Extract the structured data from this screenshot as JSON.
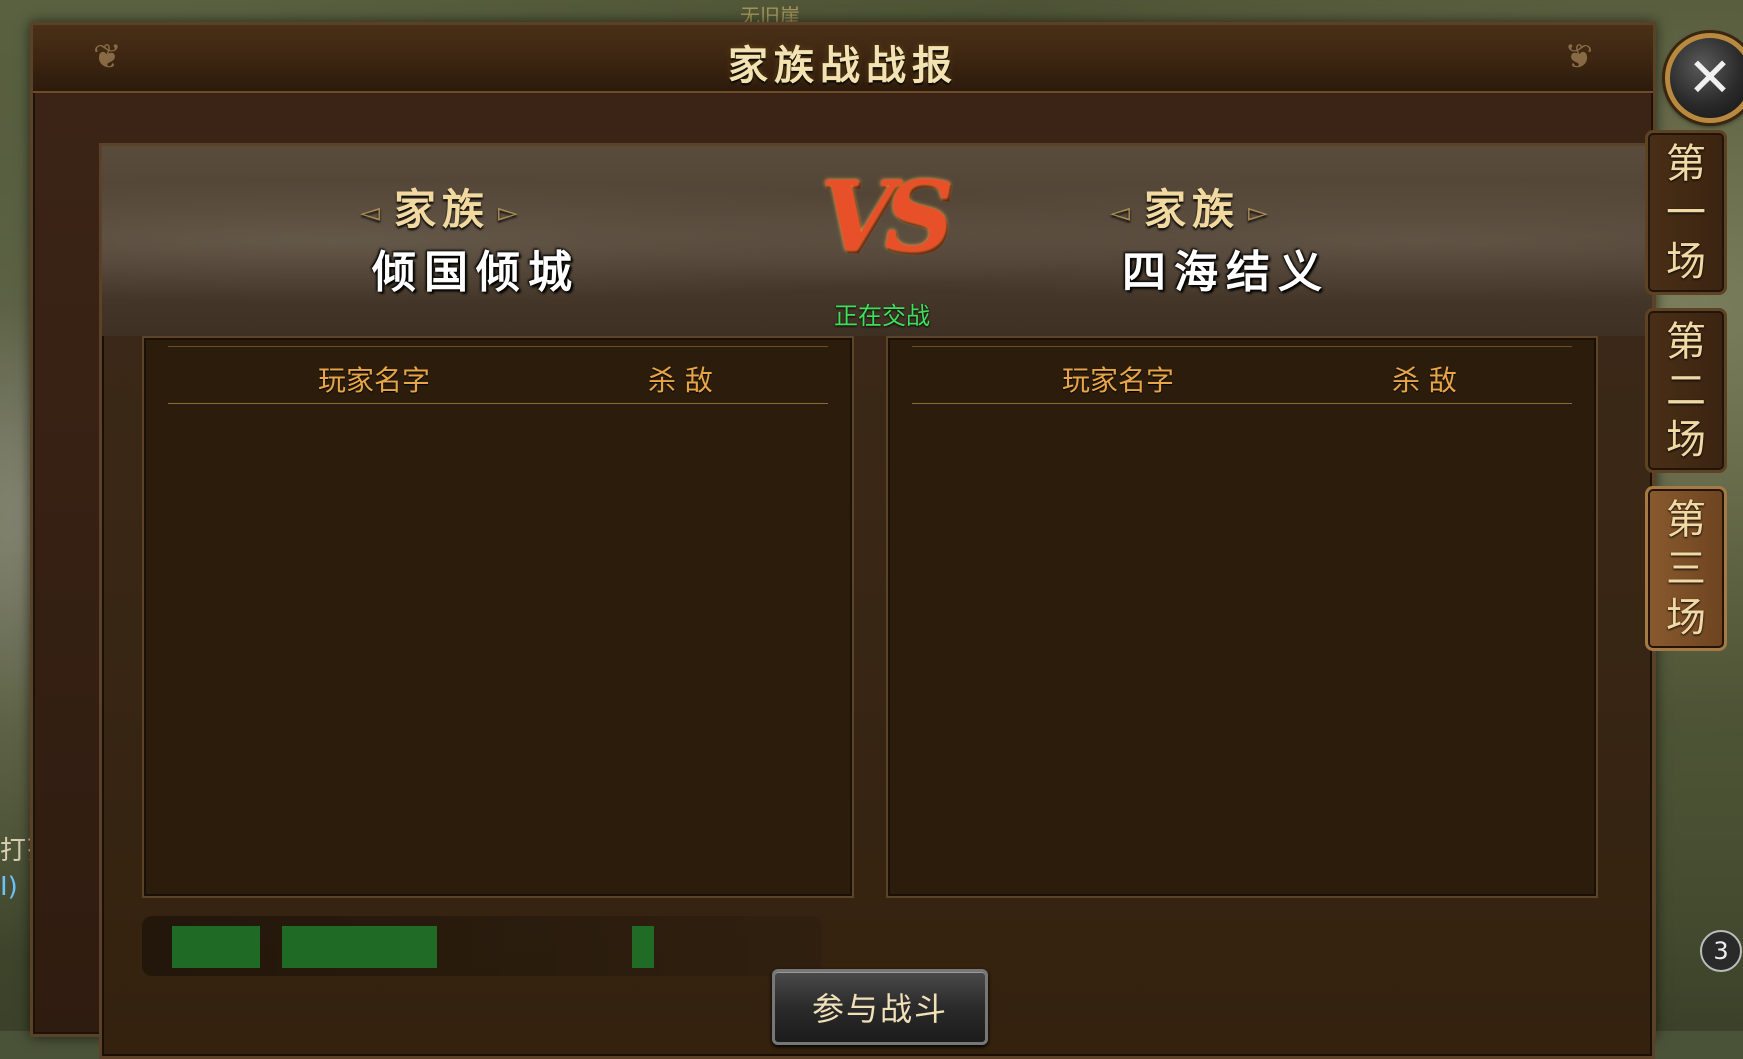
{
  "world": {
    "top_text": "无旧崖",
    "left_texts": [
      "打歹",
      "I)"
    ]
  },
  "window": {
    "title": "家族战战报",
    "close_icon": "close-icon"
  },
  "header": {
    "left_clan_label": "家族",
    "left_clan_name": "倾国倾城",
    "vs_text": "VS",
    "status": "正在交战",
    "right_clan_label": "家族",
    "right_clan_name": "四海结义"
  },
  "tables": {
    "left": {
      "col_player": "玩家名字",
      "col_kills": "杀 敌",
      "rows": []
    },
    "right": {
      "col_player": "玩家名字",
      "col_kills": "杀 敌",
      "rows": []
    }
  },
  "action_button": "参与战斗",
  "side_tabs": [
    {
      "chars": [
        "第",
        "一",
        "场"
      ],
      "active": false
    },
    {
      "chars": [
        "第",
        "二",
        "场"
      ],
      "active": false
    },
    {
      "chars": [
        "第",
        "三",
        "场"
      ],
      "active": true
    }
  ],
  "notification_count": "3",
  "colors": {
    "title": "#f3e3b3",
    "status_green": "#3ce05a",
    "column_header": "#e7a548",
    "vs_red": "#e8502a",
    "frame_brown": "#3c2516"
  }
}
